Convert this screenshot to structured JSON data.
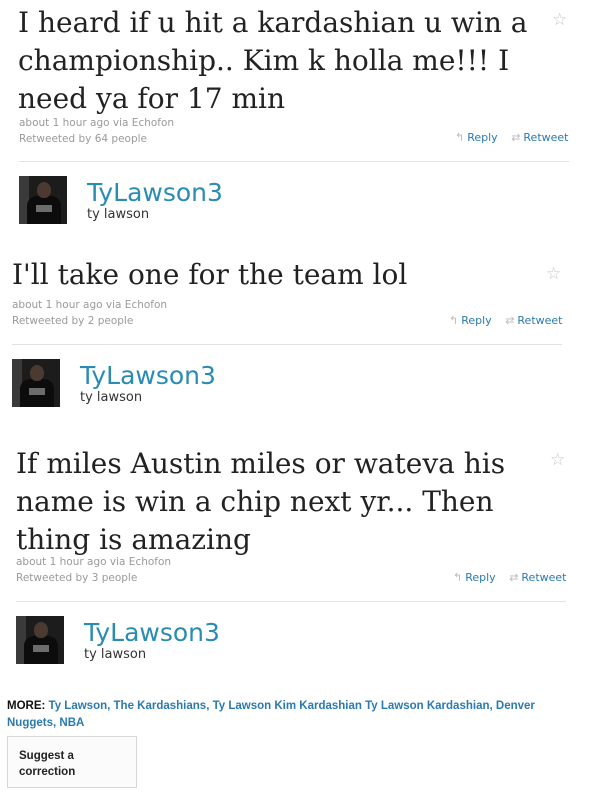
{
  "tweets": [
    {
      "text": "I heard if u hit a kardashian u win a championship.. Kim k holla me!!! I need ya for 17 min",
      "time": "about 1 hour ago via Echofon",
      "retweets": "Retweeted by 64 people",
      "reply": "Reply",
      "retweet": "Retweet",
      "screen_name": "TyLawson3",
      "real_name": "ty lawson"
    },
    {
      "text": "I'll take one for the team lol",
      "time": "about 1 hour ago via Echofon",
      "retweets": "Retweeted by 2 people",
      "reply": "Reply",
      "retweet": "Retweet",
      "screen_name": "TyLawson3",
      "real_name": "ty lawson"
    },
    {
      "text": "If miles Austin miles or wateva his name is win a chip next yr... Then thing is amazing",
      "time": "about 1 hour ago via Echofon",
      "retweets": "Retweeted by 3 people",
      "reply": "Reply",
      "retweet": "Retweet",
      "screen_name": "TyLawson3",
      "real_name": "ty lawson"
    }
  ],
  "icons": {
    "star": "star-icon",
    "reply": "reply-icon",
    "retweet": "retweet-icon"
  },
  "colors": {
    "link": "#2a7ab0",
    "screen_name": "#2a8bb3",
    "meta": "#9a9a9a"
  },
  "more": {
    "label": "MORE:",
    "tags": [
      "Ty Lawson",
      "The Kardashians",
      "Ty Lawson Kim Kardashian Ty Lawson Kardashian",
      "Denver Nuggets",
      "NBA"
    ]
  },
  "suggest": {
    "label": "Suggest a correction"
  }
}
